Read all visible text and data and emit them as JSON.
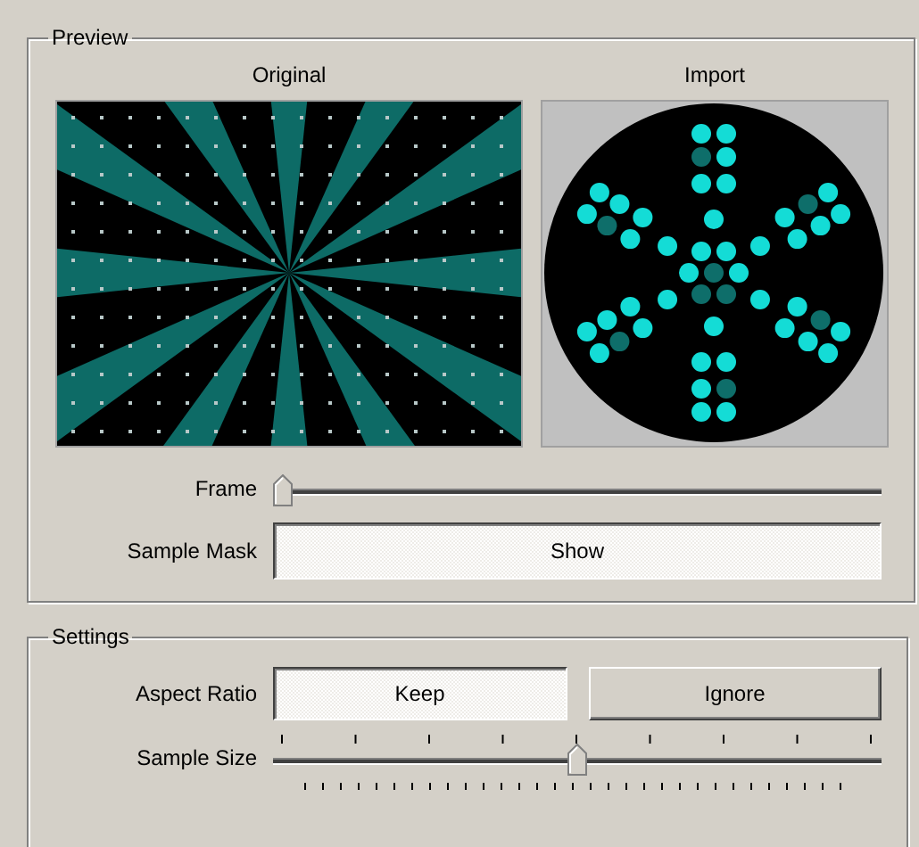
{
  "preview": {
    "title": "Preview",
    "images": [
      {
        "label": "Original",
        "kind": "starburst"
      },
      {
        "label": "Import",
        "kind": "dots"
      }
    ],
    "frame": {
      "label": "Frame",
      "level": 0
    },
    "sample_mask": {
      "label": "Sample Mask",
      "button": "Show",
      "pressed": true
    }
  },
  "settings": {
    "title": "Settings",
    "aspect_ratio": {
      "label": "Aspect Ratio",
      "options": [
        {
          "label": "Keep",
          "selected": true
        },
        {
          "label": "Ignore",
          "selected": false
        }
      ]
    },
    "sample_size": {
      "label": "Sample Size",
      "level": 0.5
    }
  }
}
